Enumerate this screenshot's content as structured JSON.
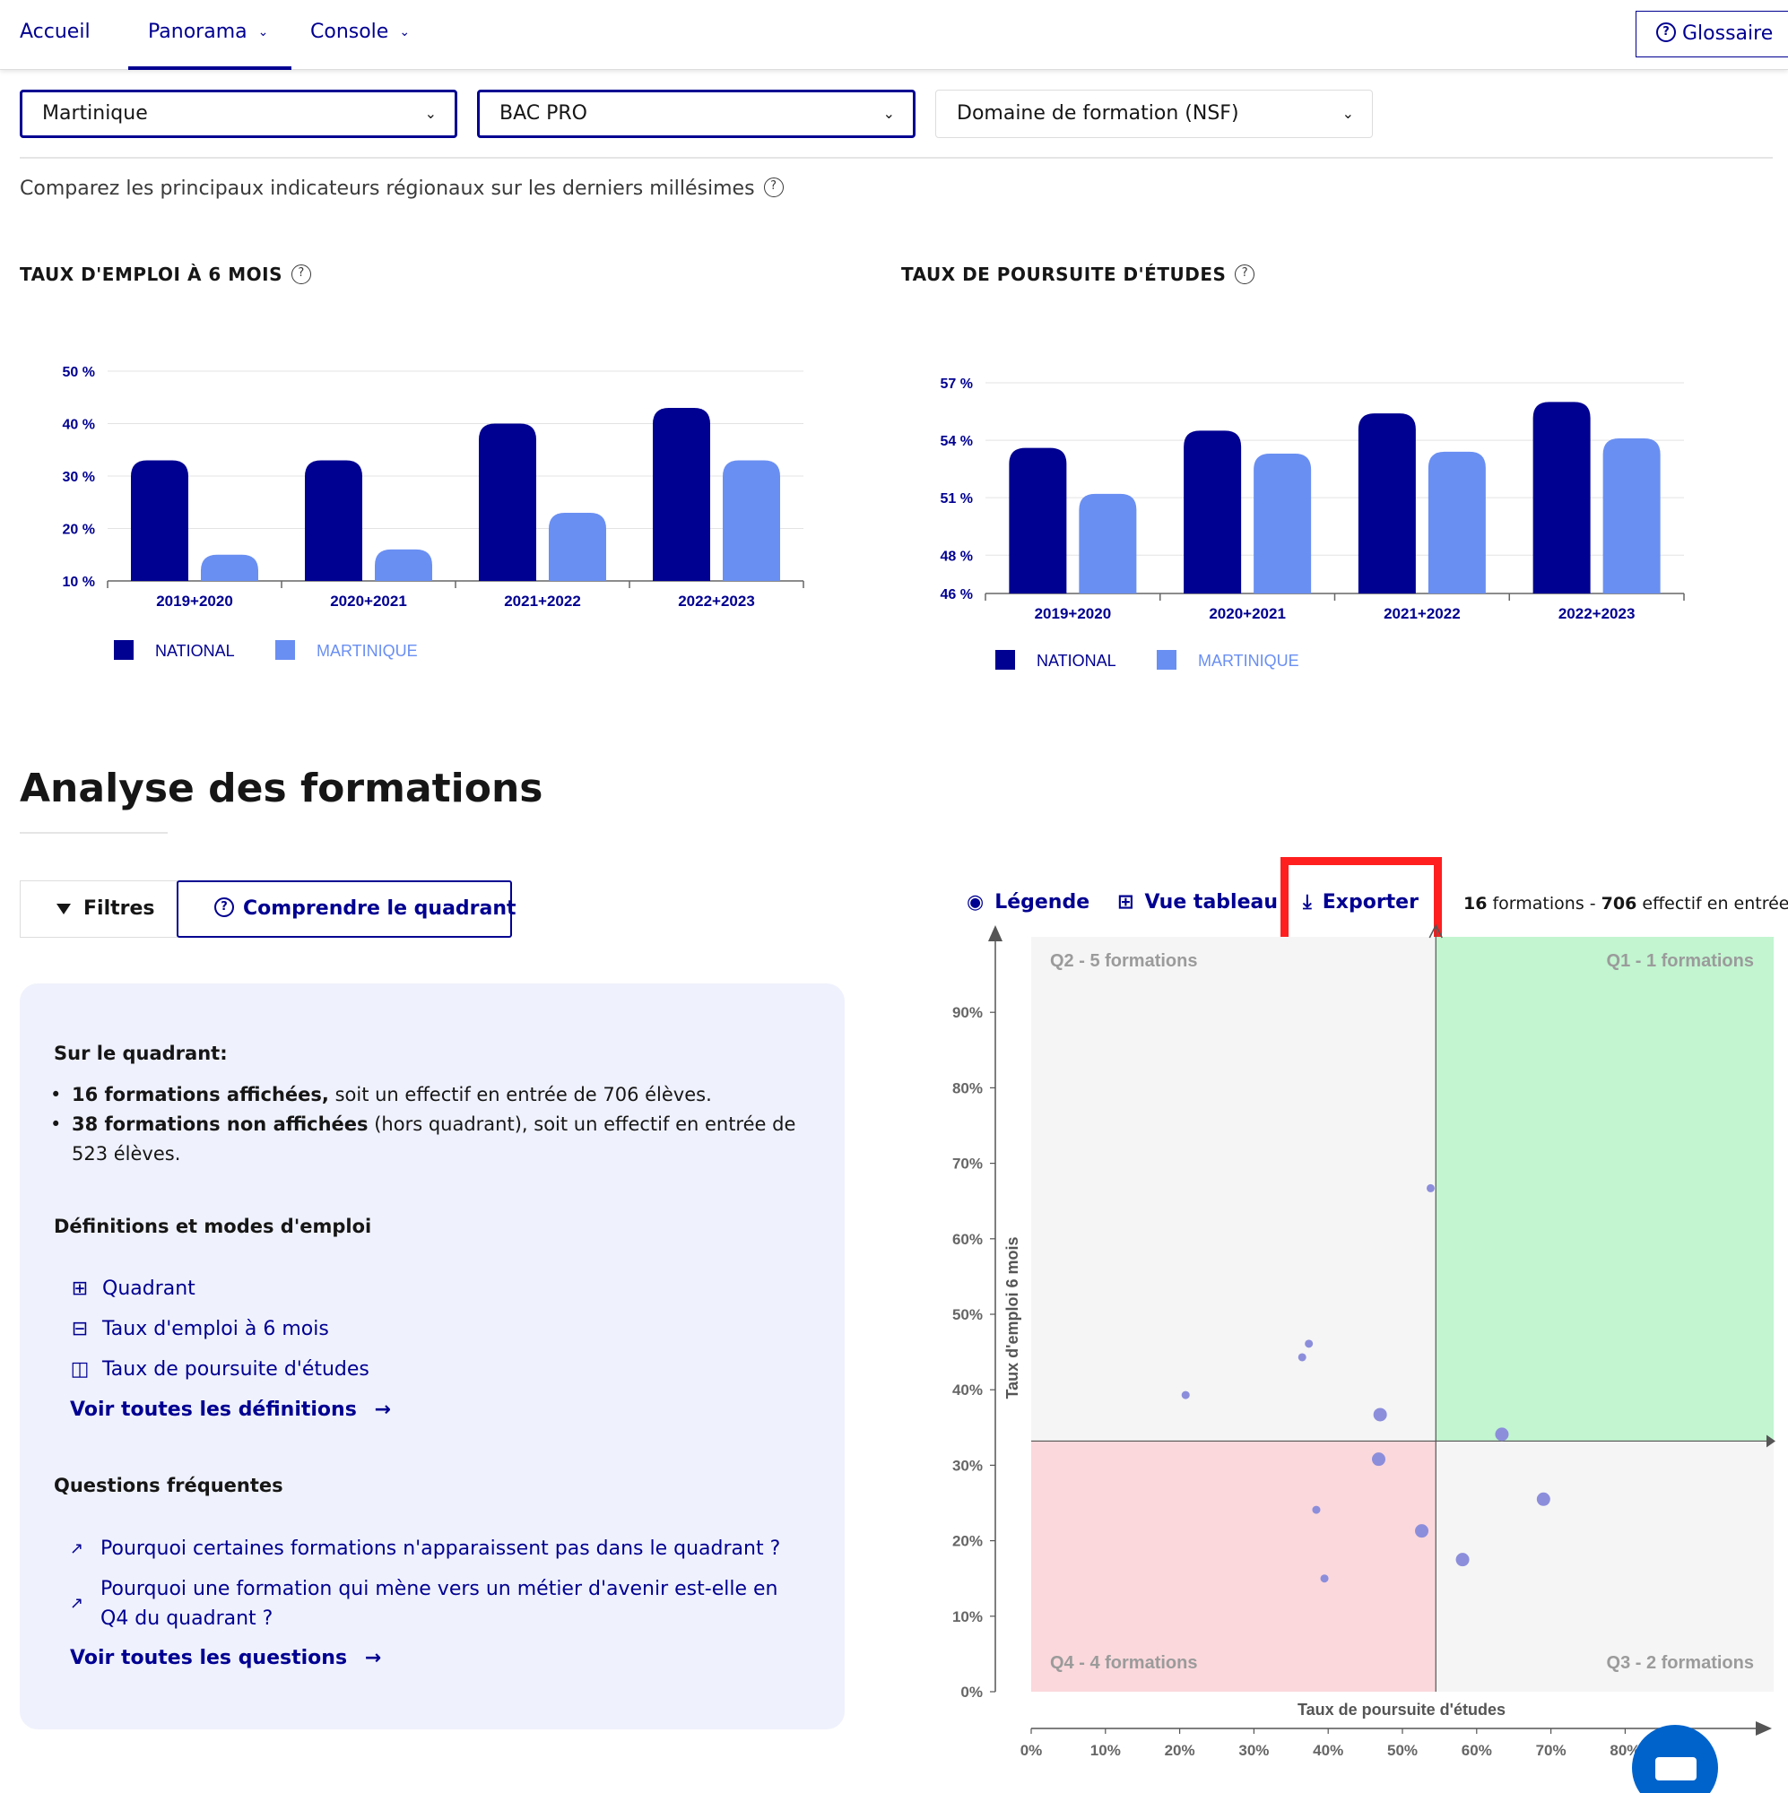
{
  "nav": {
    "items": [
      {
        "label": "Accueil",
        "active": false,
        "has_dropdown": false
      },
      {
        "label": "Panorama",
        "active": true,
        "has_dropdown": true
      },
      {
        "label": "Console",
        "active": false,
        "has_dropdown": true
      }
    ],
    "glossary_label": "Glossaire"
  },
  "filters": {
    "region": "Martinique",
    "diploma": "BAC PRO",
    "domain_placeholder": "Domaine de formation (NSF)"
  },
  "intro_text": "Comparez les principaux indicateurs régionaux sur les derniers millésimes",
  "colors": {
    "national": "#000091",
    "region": "#6a8ff2",
    "q1": "#c2f5d0",
    "q2": "#f5f5f5",
    "q3": "#f5f5f5",
    "q4": "#fbd8dc",
    "point": "#8c8edb"
  },
  "charts": {
    "emploi": {
      "title": "TAUX D'EMPLOI À 6 MOIS",
      "legend": {
        "national": "NATIONAL",
        "region": "MARTINIQUE"
      }
    },
    "poursuite": {
      "title": "TAUX DE POURSUITE D'ÉTUDES",
      "legend": {
        "national": "NATIONAL",
        "region": "MARTINIQUE"
      }
    }
  },
  "chart_data": [
    {
      "type": "bar",
      "title": "TAUX D'EMPLOI À 6 MOIS",
      "categories": [
        "2019+2020",
        "2020+2021",
        "2021+2022",
        "2022+2023"
      ],
      "series": [
        {
          "name": "NATIONAL",
          "values": [
            33,
            33,
            40,
            43
          ]
        },
        {
          "name": "MARTINIQUE",
          "values": [
            15,
            16,
            23,
            33
          ]
        }
      ],
      "y_ticks": [
        "10 %",
        "20 %",
        "30 %",
        "40 %",
        "50 %"
      ],
      "ylim": [
        10,
        50
      ],
      "grid": true,
      "legend_position": "bottom-left"
    },
    {
      "type": "bar",
      "title": "TAUX DE POURSUITE D'ÉTUDES",
      "categories": [
        "2019+2020",
        "2020+2021",
        "2021+2022",
        "2022+2023"
      ],
      "series": [
        {
          "name": "NATIONAL",
          "values": [
            53.6,
            54.5,
            55.4,
            56
          ]
        },
        {
          "name": "MARTINIQUE",
          "values": [
            51.2,
            53.3,
            53.4,
            54.1
          ]
        }
      ],
      "y_ticks": [
        "46 %",
        "48 %",
        "51 %",
        "54 %",
        "57 %"
      ],
      "ylim": [
        46,
        57
      ],
      "grid": true,
      "legend_position": "bottom-left"
    },
    {
      "type": "scatter",
      "title": "",
      "xlabel": "Taux de poursuite d'études",
      "ylabel": "Taux d'emploi 6 mois",
      "x_ticks": [
        "0%",
        "10%",
        "20%",
        "30%",
        "40%",
        "50%",
        "60%",
        "70%",
        "80%"
      ],
      "y_ticks": [
        "0%",
        "10%",
        "20%",
        "30%",
        "40%",
        "50%",
        "60%",
        "70%",
        "80%",
        "90%"
      ],
      "xlim": [
        0,
        100
      ],
      "ylim": [
        0,
        100
      ],
      "quadrant_split": {
        "x": 54.5,
        "y": 33.2
      },
      "quadrants": [
        {
          "id": "Q1",
          "label": "Q1 - 1 formations"
        },
        {
          "id": "Q2",
          "label": "Q2 - 5 formations"
        },
        {
          "id": "Q3",
          "label": "Q3 - 2 formations"
        },
        {
          "id": "Q4",
          "label": "Q4 - 4 formations"
        }
      ],
      "points": [
        {
          "x": 53.8,
          "y": 66.7,
          "size": "small"
        },
        {
          "x": 37.4,
          "y": 46.1,
          "size": "small"
        },
        {
          "x": 36.5,
          "y": 44.3,
          "size": "small"
        },
        {
          "x": 20.8,
          "y": 39.3,
          "size": "small"
        },
        {
          "x": 47.0,
          "y": 36.7,
          "size": "medium"
        },
        {
          "x": 46.8,
          "y": 30.8,
          "size": "medium"
        },
        {
          "x": 63.4,
          "y": 34.1,
          "size": "medium"
        },
        {
          "x": 69.0,
          "y": 25.5,
          "size": "medium"
        },
        {
          "x": 38.4,
          "y": 24.1,
          "size": "small"
        },
        {
          "x": 52.6,
          "y": 21.3,
          "size": "medium"
        },
        {
          "x": 58.1,
          "y": 17.5,
          "size": "medium"
        },
        {
          "x": 39.5,
          "y": 15.0,
          "size": "small"
        }
      ]
    }
  ],
  "analysis": {
    "title": "Analyse des formations",
    "btn_filtres": "Filtres",
    "btn_quadrant": "Comprendre le quadrant",
    "panel": {
      "quadrant_title": "Sur le quadrant:",
      "bullet1_bold": "16 formations affichées,",
      "bullet1_rest": " soit un effectif en entrée de 706 élèves.",
      "bullet2_bold": "38 formations non affichées",
      "bullet2_rest": " (hors quadrant), soit un effectif en entrée de 523 élèves.",
      "defs_title": "Définitions et modes d'emploi",
      "defs": [
        "Quadrant",
        "Taux d'emploi à 6 mois",
        "Taux de poursuite d'études"
      ],
      "defs_more": "Voir toutes les définitions",
      "faq_title": "Questions fréquentes",
      "faq": [
        "Pourquoi certaines formations n'apparaissent pas dans le quadrant ?",
        "Pourquoi une formation qui mène vers un métier d'avenir est-elle en Q4 du quadrant ?"
      ],
      "faq_more": "Voir toutes les questions"
    },
    "toolbar": {
      "legend": "Légende",
      "table_view": "Vue tableau",
      "export": "Exporter"
    },
    "summary": {
      "count": "16",
      "count_label": " formations - ",
      "effectif": "706",
      "effectif_label": " effectif en entrée"
    }
  }
}
